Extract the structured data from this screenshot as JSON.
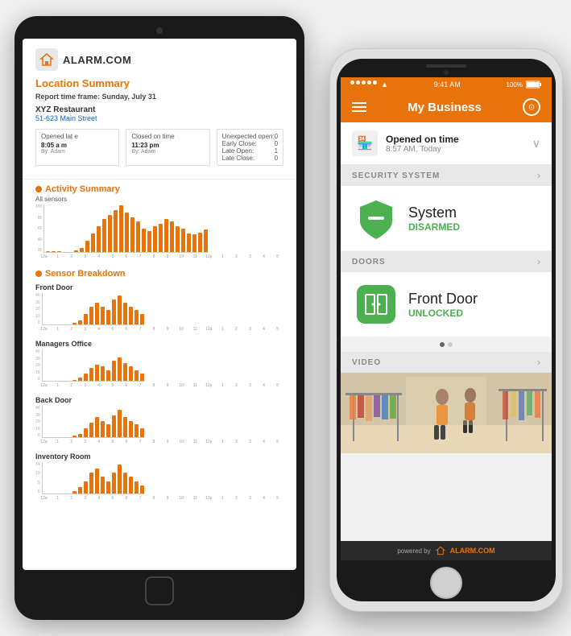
{
  "tablet": {
    "logo_text": "ALARM.COM",
    "location_summary_title": "Location Summary",
    "report_timeframe": "Report time frame: Sunday, July 31",
    "location_name": "XYZ Restaurant",
    "location_address": "51-623 Main Street",
    "stat_opened": {
      "label": "Opened lat e",
      "value": "8:05 a m",
      "sub": "By: Adam"
    },
    "stat_closed": {
      "label": "Closed on time",
      "value": "11:23 pm",
      "sub": "By: Adam"
    },
    "unexpected": {
      "label": "Unexpected open:",
      "early_close_label": "Early Close:",
      "late_open_label": "Late Open:",
      "late_close_label": "Late Close:",
      "values": "0\n0\n1\n0"
    },
    "activity_summary_title": "Activity Summary",
    "activity_chart_label": "All sensors",
    "sensor_breakdown_title": "Sensor Breakdown",
    "sensors": [
      "Front Door",
      "Managers Office",
      "Back Door",
      "Inventory Room"
    ],
    "x_labels": [
      "12a",
      "1",
      "2",
      "3",
      "4",
      "5",
      "6",
      "7",
      "8",
      "9",
      "10",
      "11",
      "12p",
      "1",
      "2",
      "3",
      "4",
      "5"
    ]
  },
  "phone": {
    "status_bar": {
      "dots": 5,
      "wifi": "wifi-icon",
      "time": "9:41 AM",
      "battery": "100%"
    },
    "nav_title": "My Business",
    "menu_icon": "hamburger-icon",
    "settings_icon": "settings-icon",
    "open_banner": {
      "title": "Opened on time",
      "subtitle": "8:57 AM, Today"
    },
    "sections": [
      {
        "id": "security",
        "header": "SECURITY SYSTEM",
        "card_title": "System",
        "card_status": "DISARMED",
        "status_color": "#4caf50"
      },
      {
        "id": "doors",
        "header": "DOORS",
        "card_title": "Front Door",
        "card_status": "UNLOCKED",
        "status_color": "#4caf50"
      },
      {
        "id": "video",
        "header": "VIDEO"
      }
    ],
    "footer": {
      "powered_by": "powered by",
      "logo": "ALARM.COM"
    }
  }
}
